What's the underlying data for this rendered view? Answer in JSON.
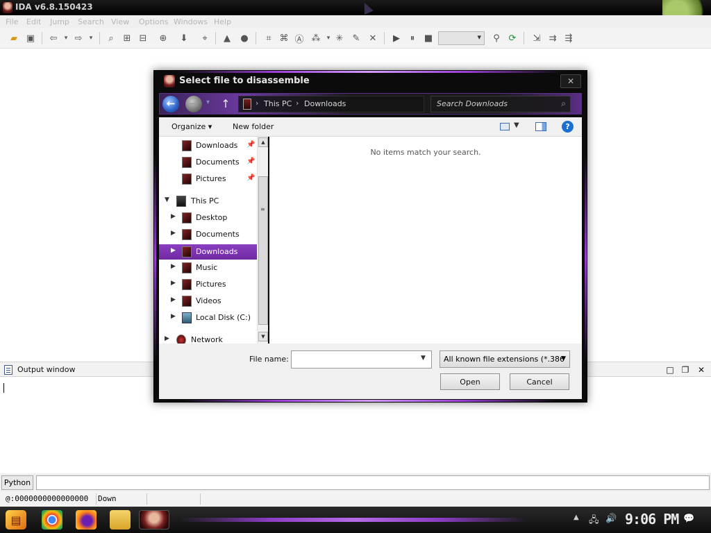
{
  "app": {
    "title": "IDA v6.8.150423"
  },
  "menu": [
    "File",
    "Edit",
    "Jump",
    "Search",
    "View",
    "Options",
    "Windows",
    "Help"
  ],
  "dialog": {
    "title": "Select file to disassemble",
    "close_label": "✕",
    "breadcrumb": [
      "This PC",
      "Downloads"
    ],
    "search_placeholder": "Search Downloads",
    "toolbar": {
      "organize": "Organize ▾",
      "new_folder": "New folder",
      "help": "?"
    },
    "nav_items": [
      {
        "label": "Downloads",
        "pinned": true
      },
      {
        "label": "Documents",
        "pinned": true
      },
      {
        "label": "Pictures",
        "pinned": true
      },
      {
        "label": "This PC"
      },
      {
        "label": "Desktop"
      },
      {
        "label": "Documents"
      },
      {
        "label": "Downloads",
        "selected": true
      },
      {
        "label": "Music"
      },
      {
        "label": "Pictures"
      },
      {
        "label": "Videos"
      },
      {
        "label": "Local Disk (C:)"
      },
      {
        "label": "Network"
      }
    ],
    "empty_message": "No items match your search.",
    "file_name_label": "File name:",
    "file_name_value": "",
    "file_type": "All known file extensions (*.386",
    "open_label": "Open",
    "cancel_label": "Cancel"
  },
  "output_window": {
    "title": "Output window"
  },
  "python": {
    "button_label": "Python"
  },
  "status": {
    "address": "@:0000000000000000",
    "direction": "Down"
  },
  "taskbar": {
    "clock": "9:06 PM"
  },
  "colors": {
    "accent_purple": "#8a3fc0",
    "back_button_blue": "#2b62c9",
    "help_blue": "#1b6fd1"
  }
}
